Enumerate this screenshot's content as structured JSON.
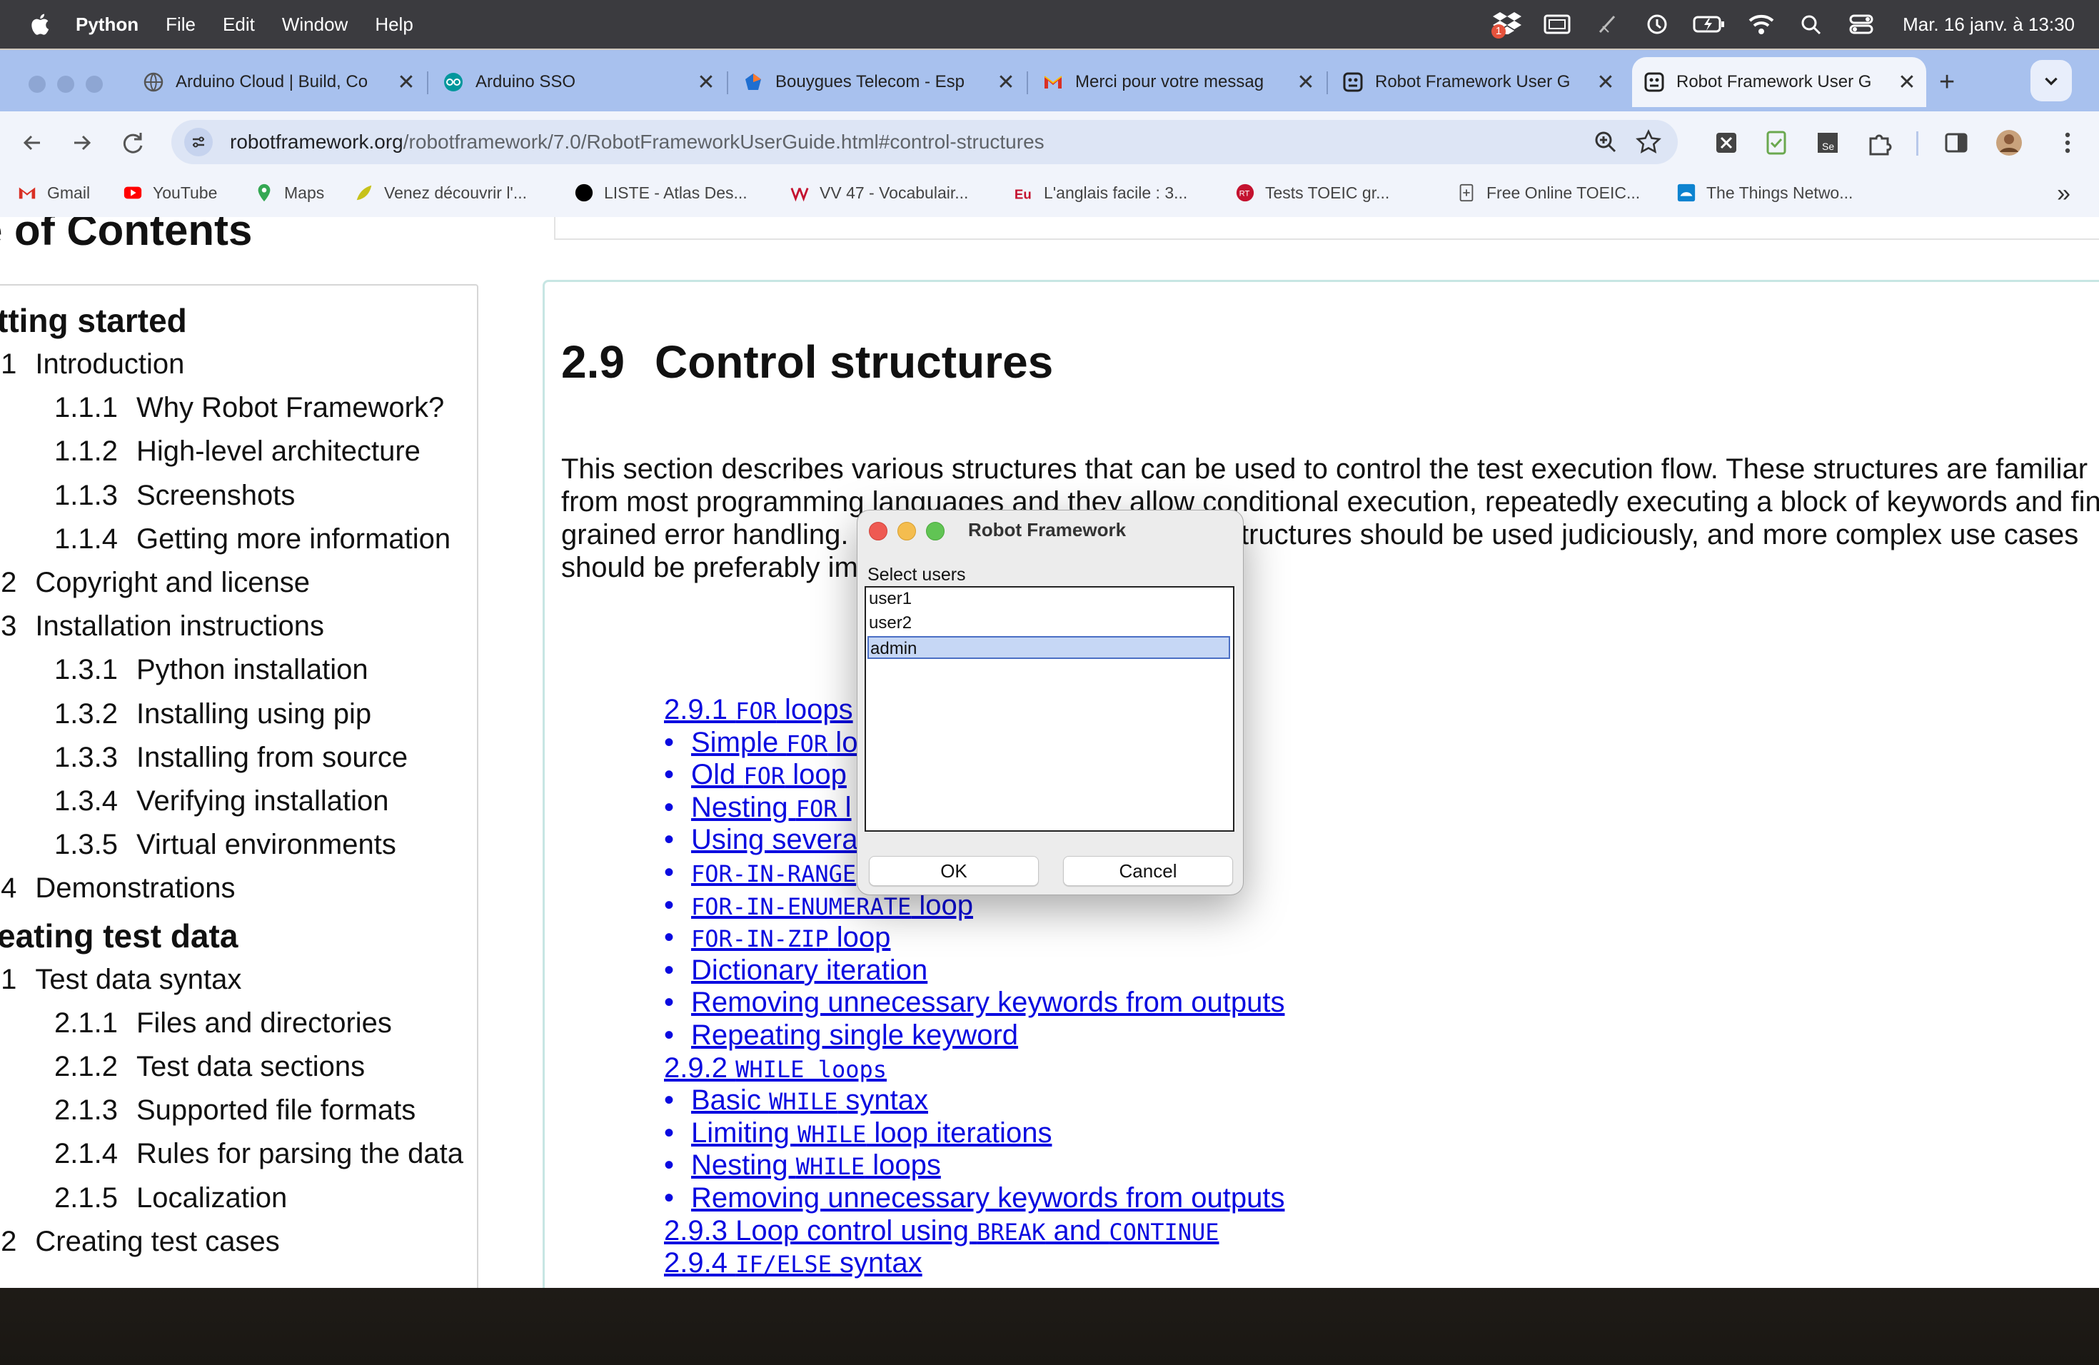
{
  "menubar": {
    "app_name": "Python",
    "menus": [
      "File",
      "Edit",
      "Window",
      "Help"
    ],
    "badge_count": "1",
    "clock": "Mar. 16 janv. à 13:30"
  },
  "tabs": [
    {
      "title": "Arduino Cloud | Build, Co",
      "icon": "arduino-cloud-icon",
      "close": "✕"
    },
    {
      "title": "Arduino SSO",
      "icon": "arduino-icon",
      "close": "✕"
    },
    {
      "title": "Bouygues Telecom - Esp",
      "icon": "bouygues-icon",
      "close": "✕"
    },
    {
      "title": "Merci pour votre messag",
      "icon": "gmail-icon",
      "close": "✕"
    },
    {
      "title": "Robot Framework User G",
      "icon": "robot-framework-icon",
      "close": "✕"
    },
    {
      "title": "Robot Framework User G",
      "icon": "robot-framework-icon",
      "close": "✕",
      "active": true
    }
  ],
  "new_tab": "+",
  "omnibox": {
    "domain": "robotframework.org",
    "path": "/robotframework/7.0/RobotFrameworkUserGuide.html#control-structures"
  },
  "bookmarks": [
    {
      "label": "Gmail",
      "icon": "gmail-icon"
    },
    {
      "label": "YouTube",
      "icon": "youtube-icon"
    },
    {
      "label": "Maps",
      "icon": "maps-icon"
    },
    {
      "label": "Venez découvrir l'...",
      "icon": "leaf-icon"
    },
    {
      "label": "LISTE - Atlas Des...",
      "icon": "circle-icon"
    },
    {
      "label": "VV 47 - Vocabulair...",
      "icon": "vv-icon"
    },
    {
      "label": "L'anglais facile : 3...",
      "icon": "eu-icon"
    },
    {
      "label": "Tests TOEIC gr...",
      "icon": "toeic-icon"
    },
    {
      "label": "Free Online TOEIC...",
      "icon": "page-plus-icon"
    },
    {
      "label": "The Things Netwo...",
      "icon": "ttn-icon"
    }
  ],
  "bookmarks_more": "»",
  "toc": {
    "heading": "e of Contents",
    "rows": [
      {
        "num": "",
        "label": "tting started",
        "level": "h1"
      },
      {
        "num": ".1",
        "label": "Introduction",
        "level": "h2"
      },
      {
        "num": "1.1.1",
        "label": "Why Robot Framework?",
        "level": "h3"
      },
      {
        "num": "1.1.2",
        "label": "High-level architecture",
        "level": "h3"
      },
      {
        "num": "1.1.3",
        "label": "Screenshots",
        "level": "h3"
      },
      {
        "num": "1.1.4",
        "label": "Getting more information",
        "level": "h3"
      },
      {
        "num": ".2",
        "label": "Copyright and license",
        "level": "h2"
      },
      {
        "num": ".3",
        "label": "Installation instructions",
        "level": "h2"
      },
      {
        "num": "1.3.1",
        "label": "Python installation",
        "level": "h3"
      },
      {
        "num": "1.3.2",
        "label": "Installing using pip",
        "level": "h3"
      },
      {
        "num": "1.3.3",
        "label": "Installing from source",
        "level": "h3"
      },
      {
        "num": "1.3.4",
        "label": "Verifying installation",
        "level": "h3"
      },
      {
        "num": "1.3.5",
        "label": "Virtual environments",
        "level": "h3"
      },
      {
        "num": ".4",
        "label": "Demonstrations",
        "level": "h2"
      },
      {
        "num": "",
        "label": "eating test data",
        "level": "h1"
      },
      {
        "num": ".1",
        "label": "Test data syntax",
        "level": "h2"
      },
      {
        "num": "2.1.1",
        "label": "Files and directories",
        "level": "h3"
      },
      {
        "num": "2.1.2",
        "label": "Test data sections",
        "level": "h3"
      },
      {
        "num": "2.1.3",
        "label": "Supported file formats",
        "level": "h3"
      },
      {
        "num": "2.1.4",
        "label": "Rules for parsing the data",
        "level": "h3"
      },
      {
        "num": "2.1.5",
        "label": "Localization",
        "level": "h3"
      },
      {
        "num": ".2",
        "label": "Creating test cases",
        "level": "h2"
      }
    ]
  },
  "section": {
    "number": "2.9",
    "title": "Control structures",
    "body_lines": [
      "This section describes various structures that can be used to control the test execution flow. These structures are familiar",
      "from most programming languages and they allow conditional execution, repeatedly executing a block of keywords and fin",
      "grained error handling.",
      "should be preferably im"
    ],
    "body_line3_tail": "tructures should be used judiciously, and more complex use cases"
  },
  "links": [
    {
      "type": "sub",
      "parts": [
        {
          "t": "2.9.1   "
        },
        {
          "t": "FOR",
          "m": true
        },
        {
          "t": " loops"
        }
      ]
    },
    {
      "type": "item",
      "parts": [
        {
          "t": "Simple "
        },
        {
          "t": "FOR",
          "m": true
        },
        {
          "t": " lo"
        }
      ]
    },
    {
      "type": "item",
      "parts": [
        {
          "t": "Old "
        },
        {
          "t": "FOR",
          "m": true
        },
        {
          "t": " loop"
        }
      ]
    },
    {
      "type": "item",
      "parts": [
        {
          "t": "Nesting "
        },
        {
          "t": "FOR",
          "m": true
        },
        {
          "t": " l"
        }
      ]
    },
    {
      "type": "item",
      "parts": [
        {
          "t": "Using severa"
        }
      ]
    },
    {
      "type": "item",
      "parts": [
        {
          "t": "FOR-IN-RANGE",
          "m": true
        }
      ]
    },
    {
      "type": "item",
      "parts": [
        {
          "t": "FOR-IN-ENUMERATE",
          "m": true
        },
        {
          "t": " loop"
        }
      ]
    },
    {
      "type": "item",
      "parts": [
        {
          "t": "FOR-IN-ZIP",
          "m": true
        },
        {
          "t": " loop"
        }
      ]
    },
    {
      "type": "item",
      "parts": [
        {
          "t": "Dictionary iteration"
        }
      ]
    },
    {
      "type": "item",
      "parts": [
        {
          "t": "Removing unnecessary keywords from outputs"
        }
      ]
    },
    {
      "type": "item",
      "parts": [
        {
          "t": "Repeating single keyword"
        }
      ]
    },
    {
      "type": "sub",
      "parts": [
        {
          "t": "2.9.2   "
        },
        {
          "t": "WHILE loops",
          "m": true
        }
      ]
    },
    {
      "type": "item",
      "parts": [
        {
          "t": "Basic "
        },
        {
          "t": "WHILE",
          "m": true
        },
        {
          "t": " syntax"
        }
      ]
    },
    {
      "type": "item",
      "parts": [
        {
          "t": "Limiting "
        },
        {
          "t": "WHILE",
          "m": true
        },
        {
          "t": " loop iterations"
        }
      ]
    },
    {
      "type": "item",
      "parts": [
        {
          "t": "Nesting "
        },
        {
          "t": "WHILE",
          "m": true
        },
        {
          "t": " loops"
        }
      ]
    },
    {
      "type": "item",
      "parts": [
        {
          "t": "Removing unnecessary keywords from outputs"
        }
      ]
    },
    {
      "type": "sub",
      "parts": [
        {
          "t": "2.9.3   Loop control using "
        },
        {
          "t": "BREAK",
          "m": true
        },
        {
          "t": " and "
        },
        {
          "t": "CONTINUE",
          "m": true
        }
      ]
    },
    {
      "type": "sub",
      "parts": [
        {
          "t": "2.9.4   "
        },
        {
          "t": "IF/ELSE",
          "m": true
        },
        {
          "t": " syntax"
        }
      ]
    }
  ],
  "dialog": {
    "title": "Robot Framework",
    "label": "Select users",
    "options": [
      "user1",
      "user2",
      "admin"
    ],
    "selected": "admin",
    "ok_label": "OK",
    "cancel_label": "Cancel"
  },
  "colors": {
    "link": "#0a0ae0",
    "tabstrip": "#a8c1ee",
    "toolbar": "#f1f4fb",
    "selection": "#c6d7f5"
  }
}
